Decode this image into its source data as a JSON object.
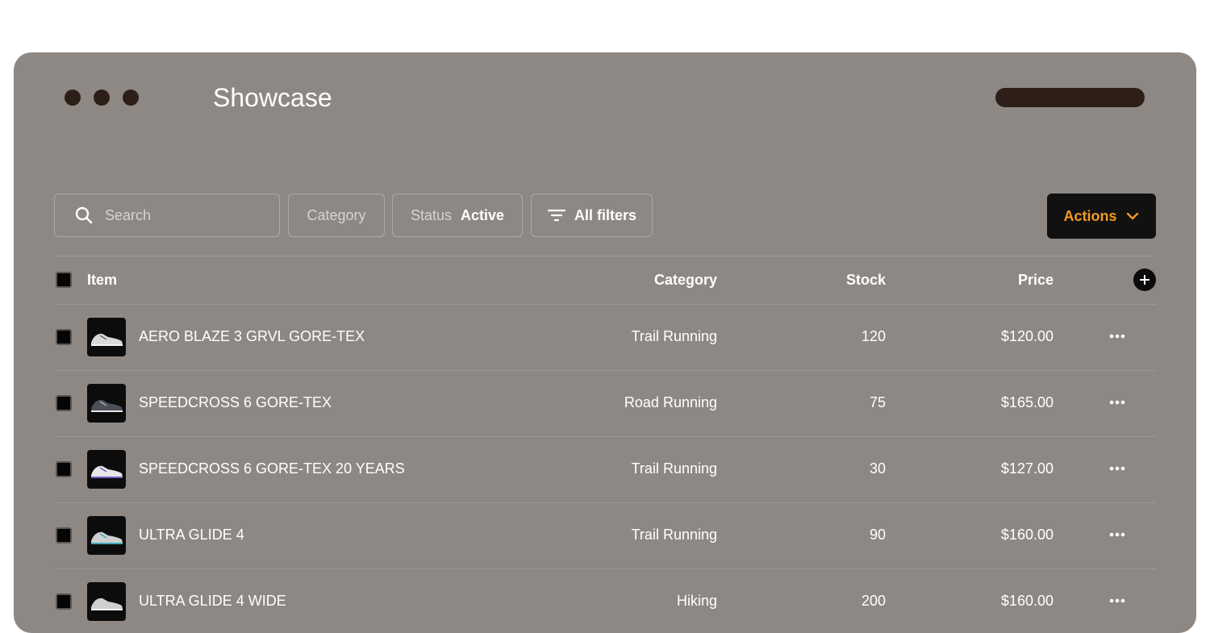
{
  "window": {
    "title": "Showcase"
  },
  "toolbar": {
    "search_placeholder": "Search",
    "category_label": "Category",
    "status_label": "Status",
    "status_value": "Active",
    "filters_label": "All filters",
    "actions_label": "Actions"
  },
  "table": {
    "headers": {
      "item": "Item",
      "category": "Category",
      "stock": "Stock",
      "price": "Price"
    },
    "rows": [
      {
        "name": "AERO BLAZE 3 GRVL GORE-TEX",
        "category": "Trail Running",
        "stock": "120",
        "price": "$120.00",
        "shoe_accent": "#d8d8d8"
      },
      {
        "name": "SPEEDCROSS 6 GORE-TEX",
        "category": "Road Running",
        "stock": "75",
        "price": "$165.00",
        "shoe_accent": "#4a4f58"
      },
      {
        "name": "SPEEDCROSS 6 GORE-TEX 20 YEARS",
        "category": "Trail Running",
        "stock": "30",
        "price": "$127.00",
        "shoe_accent": "#6b5fc2"
      },
      {
        "name": "ULTRA GLIDE 4",
        "category": "Trail Running",
        "stock": "90",
        "price": "$160.00",
        "shoe_accent": "#3fa7b8"
      },
      {
        "name": "ULTRA GLIDE 4 WIDE",
        "category": "Hiking",
        "stock": "200",
        "price": "$160.00",
        "shoe_accent": "#cfcfcf"
      }
    ]
  },
  "colors": {
    "window_bg": "#8e8884",
    "window_control": "#2d1f17",
    "actions_bg": "#111111",
    "actions_text": "#f29a1f"
  }
}
